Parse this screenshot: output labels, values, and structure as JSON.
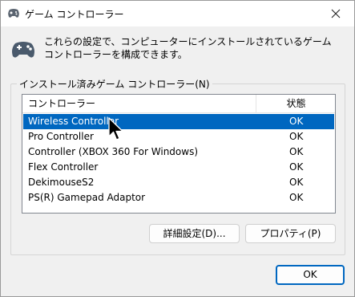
{
  "window": {
    "title": "ゲーム コントローラー",
    "description": "これらの設定で、コンピューターにインストールされているゲーム コントローラーを構成できます。"
  },
  "group": {
    "label": "インストール済みゲーム コントローラー(N)"
  },
  "list": {
    "columns": [
      "コントローラー",
      "状態"
    ],
    "selected_index": 0,
    "rows": [
      {
        "name": "Wireless Controller",
        "status": "OK"
      },
      {
        "name": "Pro Controller",
        "status": "OK"
      },
      {
        "name": "Controller (XBOX 360 For Windows)",
        "status": "OK"
      },
      {
        "name": "Flex Controller",
        "status": "OK"
      },
      {
        "name": "DekimouseS2",
        "status": "OK"
      },
      {
        "name": "PS(R) Gamepad Adaptor",
        "status": "OK"
      }
    ]
  },
  "buttons": {
    "advanced": "詳細設定(D)...",
    "properties": "プロパティ(P)",
    "ok": "OK"
  },
  "colors": {
    "selection": "#0067c0",
    "dialog_bg": "#f0f0f0"
  },
  "icons": {
    "title": "gamepad-icon",
    "header": "gamepad-icon",
    "close": "close-icon",
    "pointer": "mouse-pointer-icon"
  }
}
